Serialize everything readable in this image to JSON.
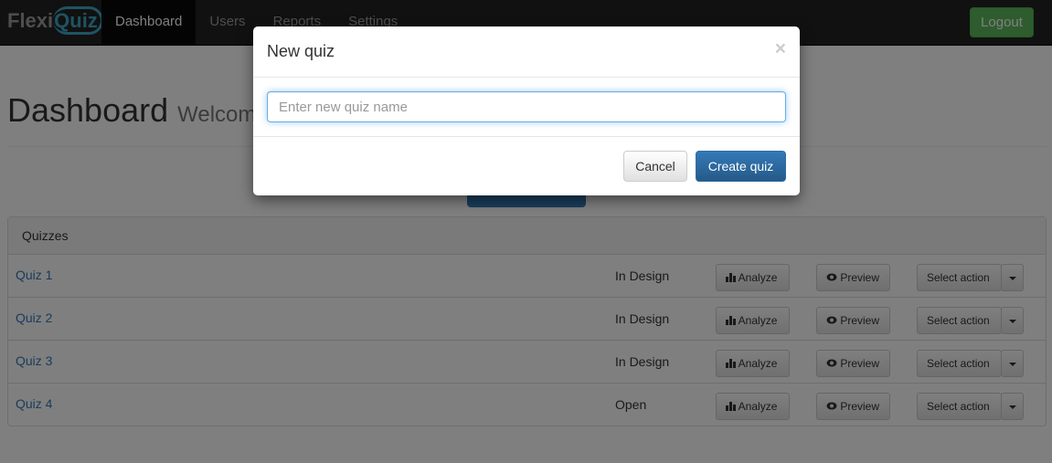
{
  "navbar": {
    "brand": "Flexi",
    "brand_accent": "Quiz",
    "items": [
      {
        "label": "Dashboard",
        "active": true
      },
      {
        "label": "Users"
      },
      {
        "label": "Reports"
      },
      {
        "label": "Settings"
      }
    ],
    "logout": "Logout"
  },
  "page": {
    "title": "Dashboard",
    "subtitle": "Welcome"
  },
  "panel": {
    "heading": "Quizzes",
    "rows": [
      {
        "name": "Quiz 1",
        "status": "In Design"
      },
      {
        "name": "Quiz 2",
        "status": "In Design"
      },
      {
        "name": "Quiz 3",
        "status": "In Design"
      },
      {
        "name": "Quiz 4",
        "status": "Open"
      }
    ],
    "analyze": "Analyze",
    "preview": "Preview",
    "select_action": "Select action"
  },
  "modal": {
    "title": "New quiz",
    "close": "×",
    "placeholder": "Enter new quiz name",
    "cancel": "Cancel",
    "create": "Create quiz"
  },
  "colors": {
    "primary": "#337ab7",
    "success": "#5cb85c",
    "navbar": "#222222"
  }
}
